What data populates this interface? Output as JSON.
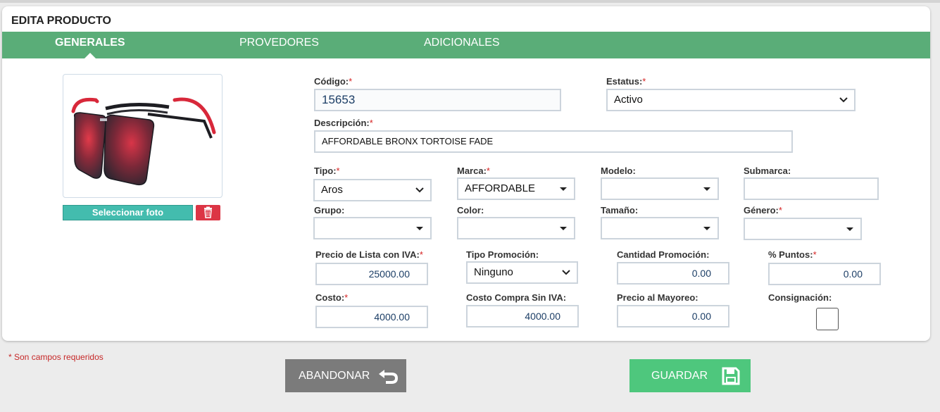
{
  "card": {
    "title": "EDITA PRODUCTO"
  },
  "tabs": [
    {
      "label": "GENERALES",
      "active": true
    },
    {
      "label": "PROVEDORES",
      "active": false
    },
    {
      "label": "ADICIONALES",
      "active": false
    }
  ],
  "photo": {
    "select_label": "Seleccionar foto",
    "icon": "trash-icon"
  },
  "form": {
    "codigo": {
      "label": "Código:",
      "value": "15653"
    },
    "estatus": {
      "label": "Estatus:",
      "value": "Activo"
    },
    "descripcion": {
      "label": "Descripción:",
      "value": "AFFORDABLE BRONX TORTOISE FADE"
    },
    "tipo": {
      "label": "Tipo:",
      "value": "Aros"
    },
    "marca": {
      "label": "Marca:",
      "value": "AFFORDABLE"
    },
    "modelo": {
      "label": "Modelo:",
      "value": ""
    },
    "submarca": {
      "label": "Submarca:",
      "value": ""
    },
    "grupo": {
      "label": "Grupo:",
      "value": ""
    },
    "color": {
      "label": "Color:",
      "value": ""
    },
    "tamano": {
      "label": "Tamaño:",
      "value": ""
    },
    "genero": {
      "label": "Género:",
      "value": ""
    },
    "precio_lista": {
      "label": "Precio de Lista con IVA:",
      "value": "25000.00"
    },
    "tipo_promocion": {
      "label": "Tipo Promoción:",
      "value": "Ninguno"
    },
    "cantidad_promocion": {
      "label": "Cantidad Promoción:",
      "value": "0.00"
    },
    "puntos": {
      "label": "% Puntos:",
      "value": "0.00"
    },
    "costo": {
      "label": "Costo:",
      "value": "4000.00"
    },
    "costo_compra": {
      "label": "Costo Compra Sin IVA:",
      "value": "4000.00"
    },
    "precio_mayoreo": {
      "label": "Precio al Mayoreo:",
      "value": "0.00"
    },
    "consignacion": {
      "label": "Consignación:",
      "checked": false
    }
  },
  "required_marker": "*",
  "required_note": "* Son campos requeridos",
  "buttons": {
    "abandon": {
      "label": "ABANDONAR",
      "icon": "undo-arrow-icon"
    },
    "save": {
      "label": "GUARDAR",
      "icon": "floppy-disk-icon"
    }
  },
  "colors": {
    "tab_bar": "#5aad78",
    "save": "#4ec77d",
    "abandon": "#7b7b7b",
    "photo_button": "#43bcae",
    "delete": "#dc3545",
    "required": "#d62222"
  }
}
